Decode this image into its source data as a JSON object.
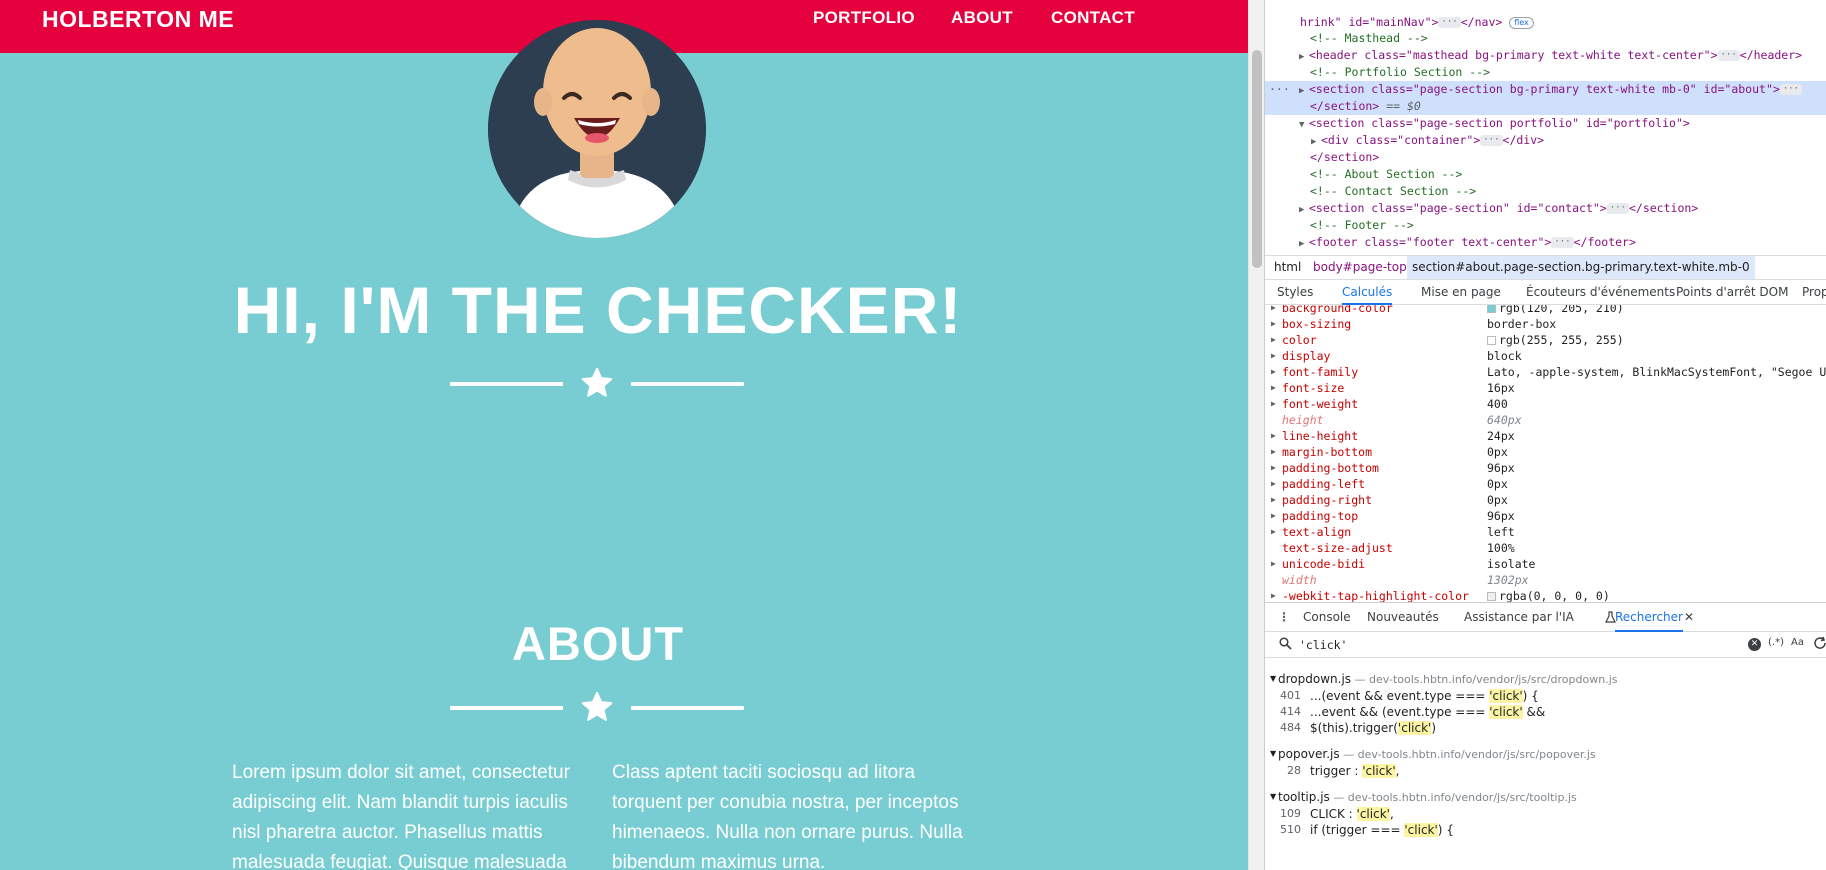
{
  "page": {
    "brand": "HOLBERTON ME",
    "nav": [
      "PORTFOLIO",
      "ABOUT",
      "CONTACT"
    ],
    "masthead_title": "HI, I'M THE CHECKER!",
    "about_title": "ABOUT",
    "about_col_1": "Lorem ipsum dolor sit amet, consectetur adipiscing elit. Nam blandit turpis iaculis nisl pharetra auctor. Phasellus mattis malesuada feugiat. Quisque malesuada",
    "about_col_2": "Class aptent taciti sociosqu ad litora torquent per conubia nostra, per inceptos himenaeos. Nulla non ornare purus. Nulla bibendum maximus urna.",
    "colors": {
      "primary": "#78cdd2",
      "secondary": "#e4013d",
      "text": "#ffffff"
    },
    "avatar_icon": "checker-avatar-illustration",
    "divider_icon": "star-icon"
  },
  "devtools": {
    "dom": {
      "line0": {
        "open": "hrink\" id=\"mainNav\">",
        "close": "</nav>",
        "badge": "flex"
      },
      "c_masthead": "<!-- Masthead -->",
      "header": {
        "open": "<header class=\"masthead bg-primary text-white text-center\">",
        "close": "</header>"
      },
      "c_portfolio": "<!-- Portfolio Section -->",
      "section_about": {
        "open": "<section class=\"page-section bg-primary text-white mb-0\" id=\"about\">",
        "close": "</section>",
        "dollar": "== $0"
      },
      "section_portfolio": "<section class=\"page-section portfolio\" id=\"portfolio\">",
      "div_container": {
        "open": "<div class=\"container\">",
        "close": "</div>"
      },
      "section_close": "</section>",
      "c_about": "<!-- About Section -->",
      "c_contact": "<!-- Contact Section -->",
      "section_contact": {
        "open": "<section class=\"page-section\" id=\"contact\">",
        "close": "</section>"
      },
      "c_footer": "<!-- Footer -->",
      "footer": {
        "open": "<footer class=\"footer text-center\">",
        "close": "</footer>"
      }
    },
    "breadcrumbs": [
      "html",
      "body#page-top",
      "section#about.page-section.bg-primary.text-white.mb-0"
    ],
    "tabs": [
      "Styles",
      "Calculés",
      "Mise en page",
      "Écouteurs d'événements",
      "Points d'arrêt DOM",
      "Propriétés"
    ],
    "active_tab": "Calculés",
    "computed": [
      {
        "name": "background-color",
        "value": "rgb(120, 205, 210)",
        "swatch": "#78cdd2"
      },
      {
        "name": "box-sizing",
        "value": "border-box"
      },
      {
        "name": "color",
        "value": "rgb(255, 255, 255)",
        "swatch": "#ffffff"
      },
      {
        "name": "display",
        "value": "block"
      },
      {
        "name": "font-family",
        "value": "Lato, -apple-system, BlinkMacSystemFont, \"Segoe UI\","
      },
      {
        "name": "font-size",
        "value": "16px"
      },
      {
        "name": "font-weight",
        "value": "400"
      },
      {
        "name": "height",
        "value": "640px",
        "inherited": true
      },
      {
        "name": "line-height",
        "value": "24px"
      },
      {
        "name": "margin-bottom",
        "value": "0px"
      },
      {
        "name": "padding-bottom",
        "value": "96px"
      },
      {
        "name": "padding-left",
        "value": "0px"
      },
      {
        "name": "padding-right",
        "value": "0px"
      },
      {
        "name": "padding-top",
        "value": "96px"
      },
      {
        "name": "text-align",
        "value": "left"
      },
      {
        "name": "text-size-adjust",
        "value": "100%",
        "no_arrow": true
      },
      {
        "name": "unicode-bidi",
        "value": "isolate"
      },
      {
        "name": "width",
        "value": "1302px",
        "inherited": true
      },
      {
        "name": "-webkit-tap-highlight-color",
        "value": "rgba(0, 0, 0, 0)",
        "swatch": "#f0f0f0"
      }
    ],
    "drawer_tabs": [
      "Console",
      "Nouveautés",
      "Assistance par l'IA",
      "Rechercher"
    ],
    "active_drawer": "Rechercher",
    "search_query": "'click'",
    "regex_label": "(.*)",
    "case_label": "Aa",
    "results": [
      {
        "file": "dropdown.js",
        "path": "dev-tools.hbtn.info/vendor/js/src/dropdown.js",
        "matches": [
          {
            "line": "401",
            "pre": "...(event && event.type === ",
            "hit": "'click'",
            "post": ") {"
          },
          {
            "line": "414",
            "pre": "...event && (event.type === ",
            "hit": "'click'",
            "post": " &&"
          },
          {
            "line": "484",
            "pre": "$(this).trigger(",
            "hit": "'click'",
            "post": ")"
          }
        ]
      },
      {
        "file": "popover.js",
        "path": "dev-tools.hbtn.info/vendor/js/src/popover.js",
        "matches": [
          {
            "line": "28",
            "pre": "trigger : ",
            "hit": "'click'",
            "post": ","
          }
        ]
      },
      {
        "file": "tooltip.js",
        "path": "dev-tools.hbtn.info/vendor/js/src/tooltip.js",
        "matches": [
          {
            "line": "109",
            "pre": "CLICK : ",
            "hit": "'click'",
            "post": ","
          },
          {
            "line": "510",
            "pre": "if (trigger === ",
            "hit": "'click'",
            "post": ") {"
          }
        ]
      }
    ]
  }
}
